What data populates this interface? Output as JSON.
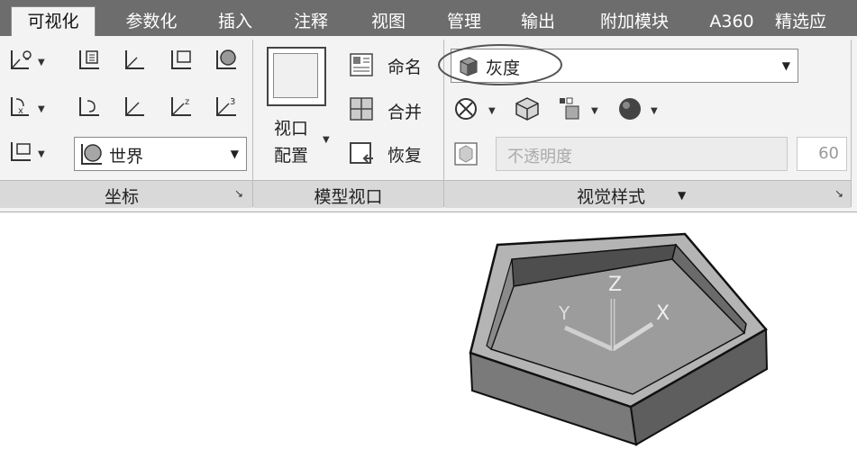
{
  "tabs": [
    "可视化",
    "参数化",
    "插入",
    "注释",
    "视图",
    "管理",
    "输出",
    "附加模块",
    "A360",
    "精选应"
  ],
  "panels": {
    "coordinates": {
      "title": "坐标",
      "ucs_value": "世界"
    },
    "model_viewports": {
      "title": "模型视口",
      "viewport_config_line1": "视口",
      "viewport_config_line2": "配置",
      "named": "命名",
      "join": "合并",
      "restore": "恢复"
    },
    "visual_styles": {
      "title": "视觉样式",
      "title_arrow": "▼",
      "style_value": "灰度",
      "opacity_placeholder": "不透明度",
      "opacity_value": "60"
    }
  },
  "viewport": {
    "ucs_labels": {
      "x": "X",
      "y": "Y",
      "z": "Z"
    }
  },
  "colors": {
    "tab_bar": "#6d6d6d",
    "ribbon_bg": "#f3f3f3",
    "panel_footer": "#d9d9d9",
    "highlight_ellipse": "#555555"
  }
}
